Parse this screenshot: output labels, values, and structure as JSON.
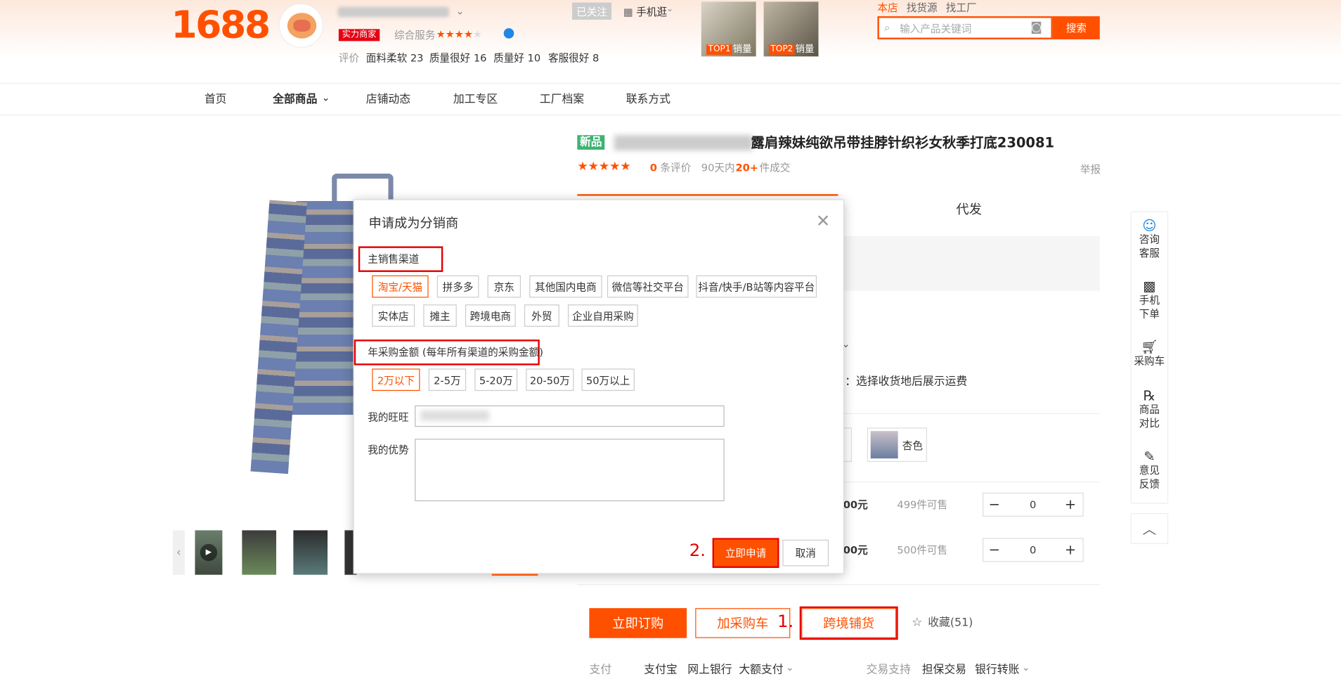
{
  "header": {
    "logo": "1688",
    "seller_badge": "实力商家",
    "service_label": "综合服务",
    "follow_btn": "已关注",
    "mobile_btn": "手机逛",
    "review_label": "评价",
    "reviews": [
      "面料柔软 23",
      "质量很好 16",
      "质量好 10",
      "客服很好 8"
    ],
    "top1": "TOP1",
    "top1_tag": "销量",
    "top2": "TOP2",
    "top2_tag": "销量",
    "search_tabs": [
      "本店",
      "找货源",
      "找工厂"
    ],
    "search_placeholder": "输入产品关键词",
    "search_btn": "搜索"
  },
  "nav": {
    "items": [
      "首页",
      "全部商品",
      "店铺动态",
      "加工专区",
      "工厂档案",
      "联系方式"
    ]
  },
  "product": {
    "new_badge": "新品",
    "title": "露肩辣妹纯欲吊带挂脖针织衫女秋季打底230081",
    "review_count": "0",
    "review_suffix": "条评价",
    "sales_prefix": "90天内",
    "sales_count": "20+",
    "sales_suffix": "件成交",
    "report": "举报",
    "tab_daifa": "代发",
    "shipping_text": "：选择收货地后展示运费",
    "color_label": "杏色",
    "price1": "00元",
    "price2": "00元",
    "stock1": "499件可售",
    "stock2": "500件可售",
    "qty1": "0",
    "qty2": "0",
    "buy_now": "立即订购",
    "add_cart": "加采购车",
    "cross_border": "跨境铺货",
    "favorite": "收藏(51)",
    "pay_label": "支付",
    "pay_methods": [
      "支付宝",
      "网上银行",
      "大额支付"
    ],
    "trade_label": "交易支持",
    "trade_methods": [
      "担保交易",
      "银行转账"
    ]
  },
  "dialog": {
    "title": "申请成为分销商",
    "channel_label": "主销售渠道",
    "channels": [
      "淘宝/天猫",
      "拼多多",
      "京东",
      "其他国内电商",
      "微信等社交平台",
      "抖音/快手/B站等内容平台",
      "实体店",
      "摊主",
      "跨境电商",
      "外贸",
      "企业自用采购"
    ],
    "amount_label": "年采购金额 (每年所有渠道的采购金额)",
    "amounts": [
      "2万以下",
      "2-5万",
      "5-20万",
      "20-50万",
      "50万以上"
    ],
    "wangwang_label": "我的旺旺",
    "advantage_label": "我的优势",
    "submit": "立即申请",
    "cancel": "取消"
  },
  "annotations": {
    "step1": "1.",
    "step2": "2."
  },
  "sidebar": {
    "items": [
      "咨询\n客服",
      "手机\n下单",
      "采购车",
      "商品\n对比",
      "意见\n反馈"
    ]
  },
  "colors": {
    "orange": "#ff5000",
    "red": "#e60000"
  }
}
